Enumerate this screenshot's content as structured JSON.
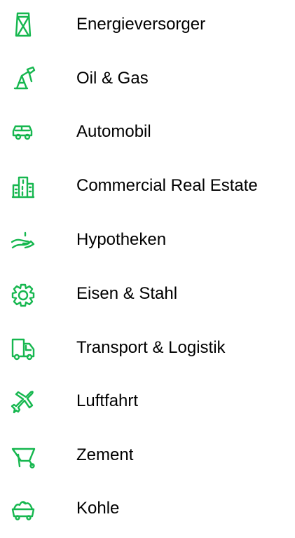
{
  "accent_color": "#16b74f",
  "sectors": [
    {
      "label": "Energieversorger",
      "icon": "power-tower-icon"
    },
    {
      "label": "Oil & Gas",
      "icon": "oil-pump-icon"
    },
    {
      "label": "Automobil",
      "icon": "car-icon"
    },
    {
      "label": "Commercial Real Estate",
      "icon": "buildings-icon"
    },
    {
      "label": "Hypotheken",
      "icon": "hand-coin-icon"
    },
    {
      "label": "Eisen & Stahl",
      "icon": "gear-icon"
    },
    {
      "label": "Transport & Logistik",
      "icon": "truck-icon"
    },
    {
      "label": "Luftfahrt",
      "icon": "airplane-icon"
    },
    {
      "label": "Zement",
      "icon": "wheelbarrow-icon"
    },
    {
      "label": "Kohle",
      "icon": "mining-cart-icon"
    }
  ]
}
